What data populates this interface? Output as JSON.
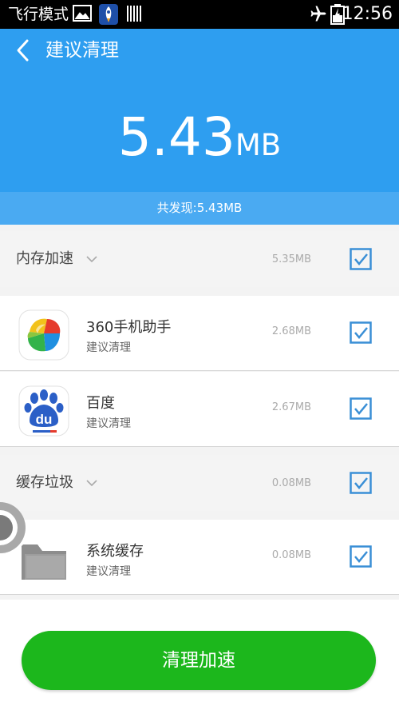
{
  "status_bar": {
    "mode_label": "飞行模式",
    "time": "12:56",
    "icons": [
      "image-icon",
      "rocket-icon",
      "barcode-icon",
      "airplane-icon",
      "battery-icon"
    ]
  },
  "header": {
    "title": "建议清理",
    "total_value": "5.43",
    "total_unit": "MB",
    "found_text": "共发现:5.43MB"
  },
  "sections": [
    {
      "label": "内存加速",
      "size": "5.35MB",
      "checked": true,
      "items": [
        {
          "name": "360手机助手",
          "sub": "建议清理",
          "size": "2.68MB",
          "icon": "app-360-assistant-icon",
          "checked": true
        },
        {
          "name": "百度",
          "sub": "建议清理",
          "size": "2.67MB",
          "icon": "baidu-icon",
          "checked": true
        }
      ]
    },
    {
      "label": "缓存垃圾",
      "size": "0.08MB",
      "checked": true,
      "items": [
        {
          "name": "系统缓存",
          "sub": "建议清理",
          "size": "0.08MB",
          "icon": "folder-icon",
          "checked": true
        }
      ]
    }
  ],
  "action": {
    "clean_label": "清理加速"
  },
  "colors": {
    "header_blue": "#2e9ef0",
    "found_bar_blue": "#4aaaf2",
    "checkbox_blue": "#3a8fd6",
    "button_green": "#1cb71c"
  }
}
